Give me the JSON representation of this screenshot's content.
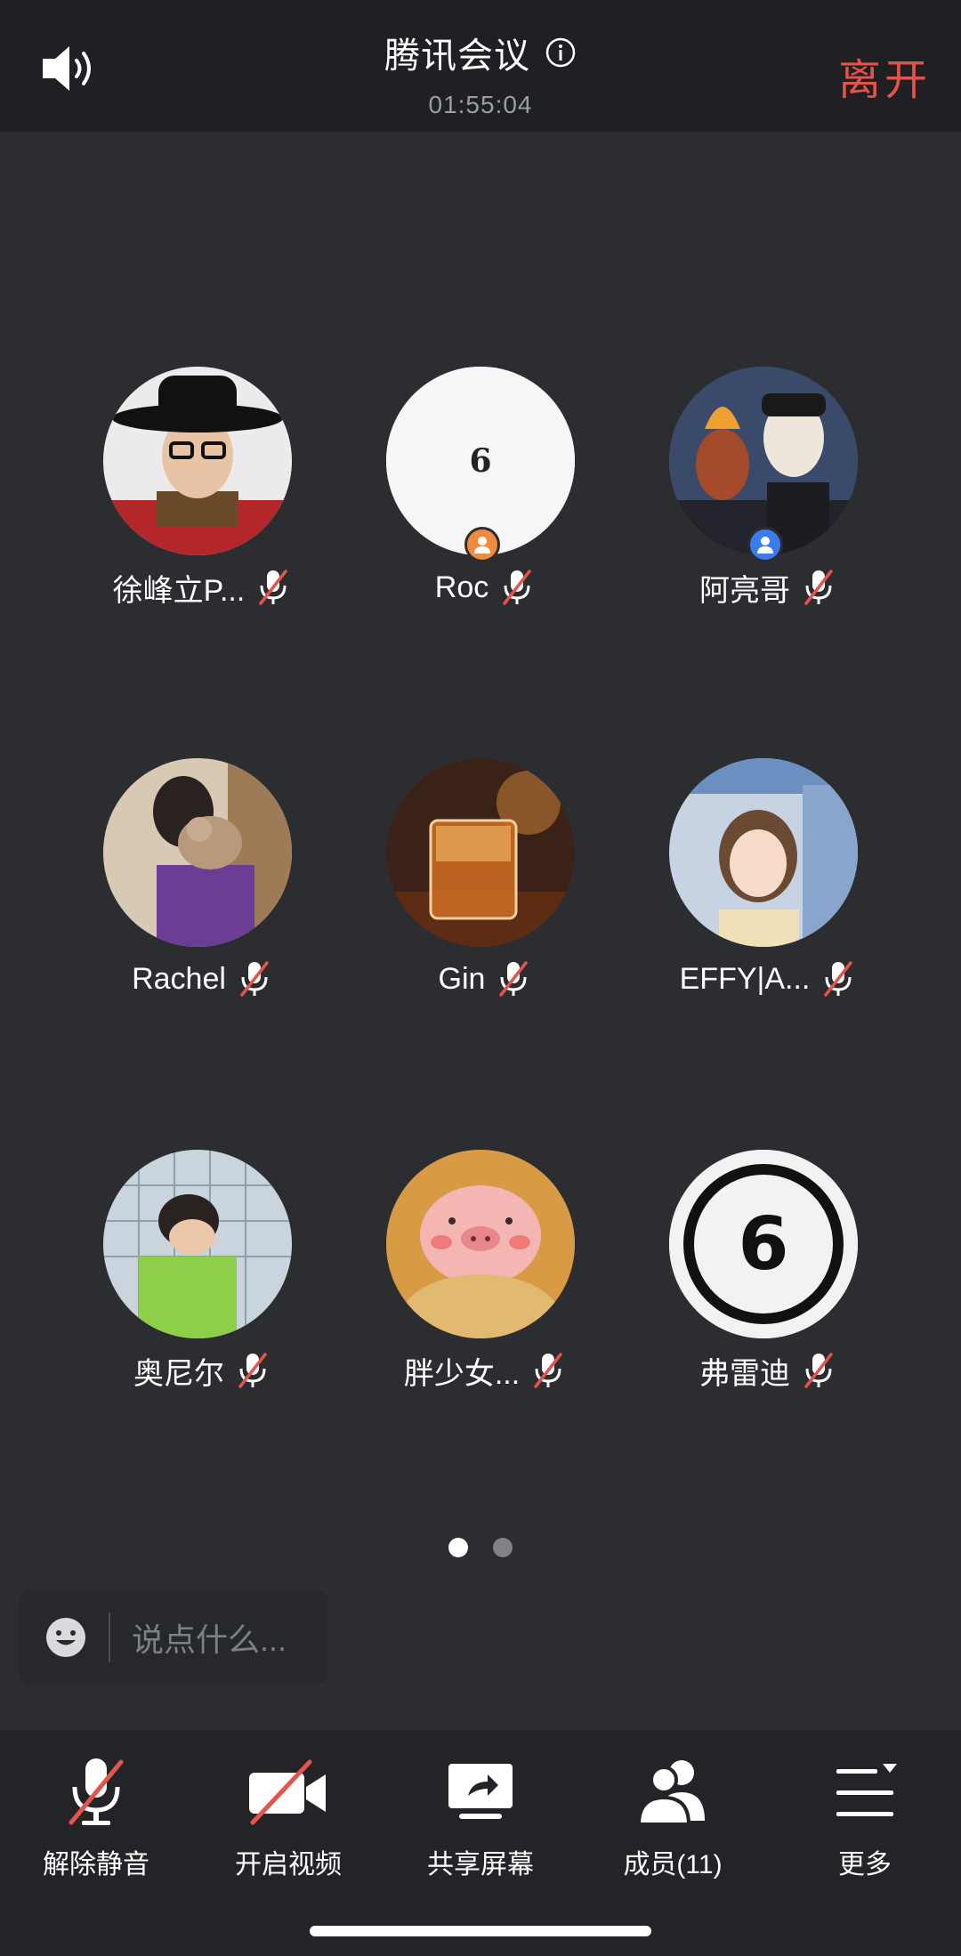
{
  "header": {
    "title": "腾讯会议",
    "timer": "01:55:04",
    "leave_label": "离开",
    "speaker_icon": "speaker-icon",
    "info_icon": "info-icon"
  },
  "participants": [
    {
      "name": "徐峰立P...",
      "avatar": "photo-hat-man",
      "muted": true,
      "badge": null
    },
    {
      "name": "Roc",
      "avatar": "white-6-logo",
      "muted": true,
      "badge": "orange-host"
    },
    {
      "name": "阿亮哥",
      "avatar": "photo-masks",
      "muted": true,
      "badge": "blue-cohost"
    },
    {
      "name": "Rachel",
      "avatar": "photo-cat-hug",
      "muted": true,
      "badge": null
    },
    {
      "name": "Gin",
      "avatar": "photo-whisky-glass",
      "muted": true,
      "badge": null
    },
    {
      "name": "EFFY|A...",
      "avatar": "photo-anime-girl",
      "muted": true,
      "badge": null
    },
    {
      "name": "奥尼尔",
      "avatar": "photo-boy-sleeping",
      "muted": true,
      "badge": null
    },
    {
      "name": "胖少女...",
      "avatar": "photo-pig-cookie",
      "muted": true,
      "badge": null
    },
    {
      "name": "弗雷迪",
      "avatar": "ring-6-logo",
      "muted": true,
      "badge": null
    }
  ],
  "pager": {
    "pages": 2,
    "current": 1
  },
  "chat": {
    "placeholder": "说点什么..."
  },
  "toolbar": {
    "unmute_label": "解除静音",
    "video_label": "开启视频",
    "share_label": "共享屏幕",
    "members_label": "成员(11)",
    "more_label": "更多"
  },
  "colors": {
    "background": "#2b2d31",
    "leave": "#e5534b",
    "host_badge": "#f08a3c",
    "cohost_badge": "#3a7bf0",
    "mute_slash": "#e5534b"
  }
}
